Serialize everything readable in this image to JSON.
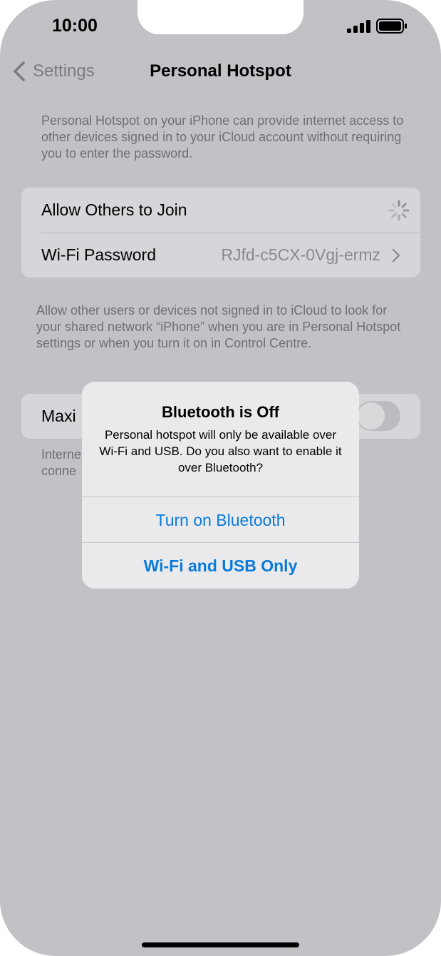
{
  "status_bar": {
    "time": "10:00"
  },
  "nav": {
    "back_label": "Settings",
    "title": "Personal Hotspot"
  },
  "intro_note": "Personal Hotspot on your iPhone can provide internet access to other devices signed in to your iCloud account without requiring you to enter the password.",
  "settings_group": {
    "allow_others_label": "Allow Others to Join",
    "wifi_password_label": "Wi-Fi Password",
    "wifi_password_value": "RJfd-c5CX-0Vgj-ermz"
  },
  "discover_note": "Allow other users or devices not signed in to iCloud to look for your shared network “iPhone” when you are in Personal Hotspot settings or when you turn it on in Control Centre.",
  "compat_group": {
    "label_partial": "Maxi"
  },
  "compat_note_partial": [
    "Interne",
    "conne"
  ],
  "alert": {
    "title": "Bluetooth is Off",
    "message": "Personal hotspot will only be available over Wi-Fi and USB. Do you also want to enable it over Bluetooth?",
    "button_turn_on": "Turn on Bluetooth",
    "button_wifi_usb": "Wi-Fi and USB Only"
  },
  "colors": {
    "background_dimmed": "#c1c1c6",
    "accent_blue": "#0a7ad8",
    "alert_background": "#eaeaec"
  }
}
